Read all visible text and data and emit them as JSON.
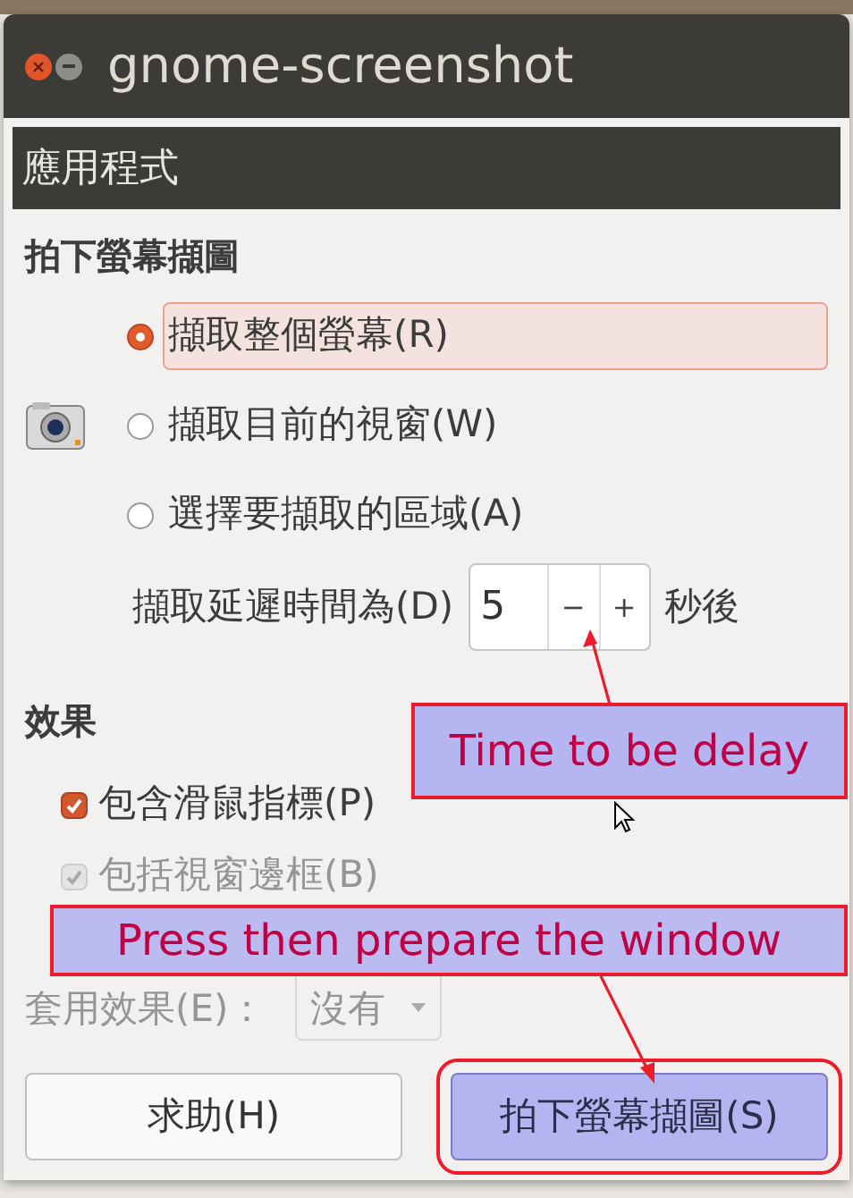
{
  "window": {
    "title": "gnome-screenshot"
  },
  "header": "應用程式",
  "capture": {
    "heading": "拍下螢幕擷圖",
    "options": [
      {
        "label": "擷取整個螢幕(R)",
        "selected": true
      },
      {
        "label": "擷取目前的視窗(W)",
        "selected": false
      },
      {
        "label": "選擇要擷取的區域(A)",
        "selected": false
      }
    ],
    "delay": {
      "label": "擷取延遲時間為(D)",
      "value": "5",
      "decrement": "−",
      "increment": "+",
      "unit": "秒後"
    }
  },
  "effects": {
    "heading": "效果",
    "checkboxes": [
      {
        "label": "包含滑鼠指標(P)",
        "checked": true,
        "disabled": false
      },
      {
        "label": "包括視窗邊框(B)",
        "checked": true,
        "disabled": true
      }
    ],
    "apply": {
      "label": "套用效果(E)：",
      "value": "沒有",
      "disabled": true
    }
  },
  "buttons": [
    {
      "label": "求助(H)",
      "highlighted": false
    },
    {
      "label": "拍下螢幕擷圖(S)",
      "highlighted": true
    }
  ],
  "annotations": [
    {
      "text": "Time to be delay"
    },
    {
      "text": "Press then prepare the window"
    }
  ]
}
